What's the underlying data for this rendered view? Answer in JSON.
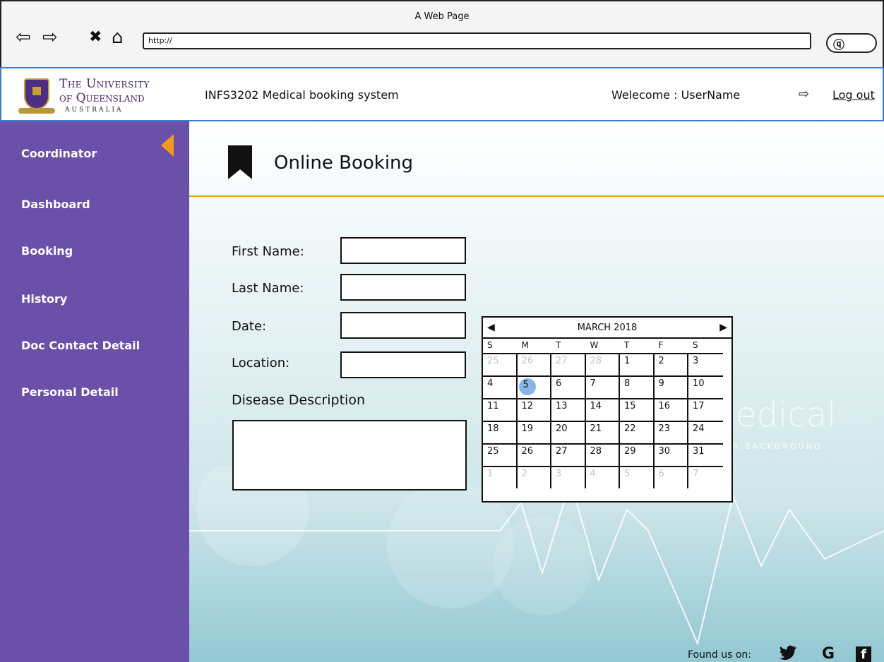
{
  "browser": {
    "window_title": "A Web Page",
    "url": "http://",
    "back_icon": "⇦",
    "forward_icon": "⇨",
    "stop_icon": "✖",
    "home_icon": "⌂",
    "search_icon": "ⓠ"
  },
  "header": {
    "logo_line1": "The University",
    "logo_line2": "of Queensland",
    "logo_line3": "AUSTRALIA",
    "app_title": "INFS3202 Medical booking system",
    "welcome": "Welecome :  UserName",
    "logout_icon": "⇨",
    "logout_label": "Log out"
  },
  "sidebar": {
    "items": [
      {
        "label": "Coordinator"
      },
      {
        "label": "Dashboard"
      },
      {
        "label": "Booking"
      },
      {
        "label": "History"
      },
      {
        "label": "Doc Contact Detail"
      },
      {
        "label": "Personal Detail"
      }
    ]
  },
  "main": {
    "title": "Online Booking",
    "fields": [
      {
        "label": "First Name:",
        "value": ""
      },
      {
        "label": "Last Name:",
        "value": ""
      },
      {
        "label": "Date:",
        "value": ""
      },
      {
        "label": "Location:",
        "value": ""
      }
    ],
    "description_label": "Disease Description",
    "description_value": "",
    "watermark": "edical",
    "watermark_sub": "R BACKGROUND"
  },
  "calendar": {
    "month_label": "MARCH 2018",
    "prev_icon": "◀",
    "next_icon": "▶",
    "weekdays": [
      "S",
      "M",
      "T",
      "W",
      "T",
      "F",
      "S"
    ],
    "weeks": [
      [
        "25",
        "26",
        "27",
        "28",
        "1",
        "2",
        "3"
      ],
      [
        "4",
        "5",
        "6",
        "7",
        "8",
        "9",
        "10"
      ],
      [
        "11",
        "12",
        "13",
        "14",
        "15",
        "16",
        "17"
      ],
      [
        "18",
        "19",
        "20",
        "21",
        "22",
        "23",
        "24"
      ],
      [
        "25",
        "26",
        "27",
        "28",
        "29",
        "30",
        "31"
      ],
      [
        "1",
        "2",
        "3",
        "4",
        "5",
        "6",
        "7"
      ]
    ],
    "selected_day": "5",
    "colors": {
      "selected": "#8ab4e6",
      "muted": "#c4c4c4"
    }
  },
  "footer": {
    "found_label": "Found us on:",
    "social": [
      {
        "name": "twitter-icon",
        "glyph": "🐦"
      },
      {
        "name": "google-icon",
        "glyph": "G"
      },
      {
        "name": "facebook-icon",
        "glyph": "f"
      }
    ]
  },
  "colors": {
    "sidebar_bg": "#6a50a8",
    "accent": "#f39a1e",
    "header_border": "#3e7bd2"
  }
}
